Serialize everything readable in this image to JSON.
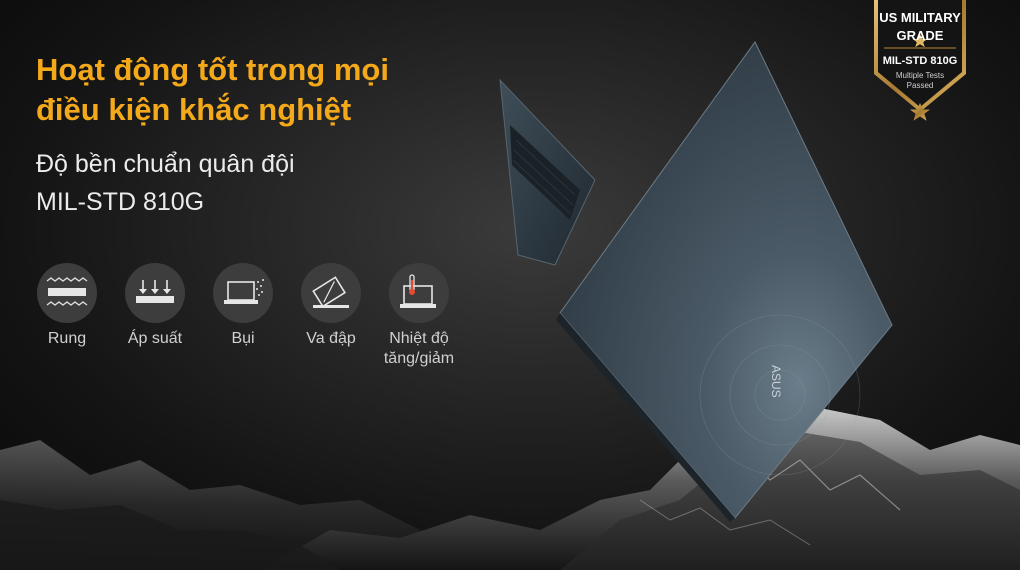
{
  "headline": {
    "line1": "Hoạt động tốt trong mọi",
    "line2": "điều kiện khắc nghiệt"
  },
  "subheadline": {
    "line1": "Độ bền chuẩn quân đội",
    "line2": "MIL-STD 810G"
  },
  "tests": [
    {
      "label": [
        "Rung"
      ],
      "icon": "vibration-icon"
    },
    {
      "label": [
        "Áp suất"
      ],
      "icon": "pressure-icon"
    },
    {
      "label": [
        "Bụi"
      ],
      "icon": "dust-icon"
    },
    {
      "label": [
        "Va đập"
      ],
      "icon": "impact-icon"
    },
    {
      "label": [
        "Nhiệt độ",
        "tăng/giảm"
      ],
      "icon": "temperature-icon"
    }
  ],
  "badge": {
    "line1": "US MILITARY",
    "line2": "GRADE",
    "line3": "MIL-STD 810G",
    "line4": "Multiple Tests",
    "line5": "Passed"
  },
  "laptop_logo": "ASUS",
  "colors": {
    "headline": "#f4a91b",
    "subheadline": "#ececec",
    "icon_bg": "#3d3d3d",
    "badge_gold": "#b8893a"
  }
}
